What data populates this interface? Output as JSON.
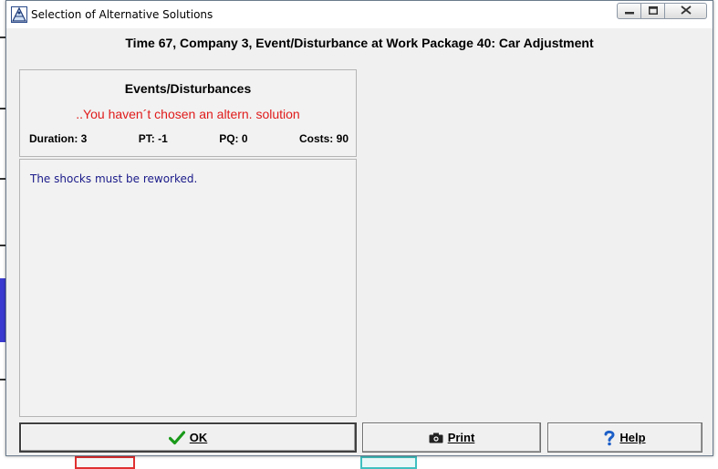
{
  "window": {
    "title": "Selection of Alternative Solutions",
    "app_icon": "pyramid-app-icon",
    "caption_icons": [
      "minimize-icon",
      "restore-icon",
      "close-icon"
    ]
  },
  "header": {
    "title": "Time 67, Company 3, Event/Disturbance at Work Package 40: Car Adjustment"
  },
  "events": {
    "title": "Events/Disturbances",
    "status": "..You haven´t chosen an altern. solution",
    "stats": {
      "duration": "Duration: 3",
      "pt": "PT: -1",
      "pq": "PQ: 0",
      "costs": "Costs: 90"
    },
    "description": "The shocks must be reworked."
  },
  "buttons": {
    "ok": {
      "label": "OK",
      "icon": "checkmark-icon"
    },
    "print": {
      "label": "Print",
      "icon": "camera-icon"
    },
    "help": {
      "label": "Help",
      "icon": "question-mark-icon"
    }
  },
  "colors": {
    "status_text": "#e01b1b",
    "description_text": "#1a1a8a",
    "ok_icon": "#1a9a1a",
    "help_icon": "#1c5fc8",
    "dialog_bg": "#f0f0f0"
  }
}
